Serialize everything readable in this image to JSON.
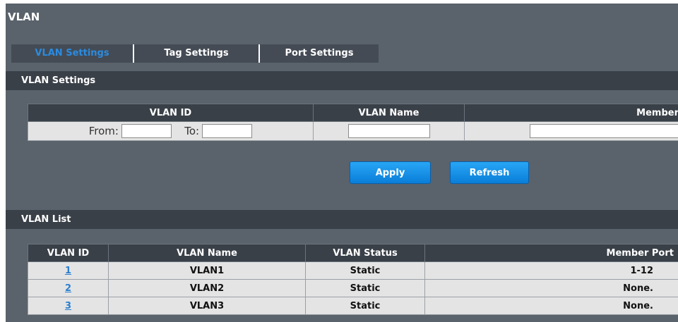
{
  "page": {
    "title": "VLAN"
  },
  "tabs": [
    {
      "label": "VLAN Settings"
    },
    {
      "label": "Tag Settings"
    },
    {
      "label": "Port Settings"
    }
  ],
  "settings": {
    "section_title": "VLAN Settings",
    "headers": {
      "vlan_id": "VLAN ID",
      "vlan_name": "VLAN Name",
      "member": "Member"
    },
    "from_label": "From:",
    "to_label": "To:",
    "from_value": "",
    "to_value": "",
    "name_value": "",
    "member_value": ""
  },
  "buttons": {
    "apply": "Apply",
    "refresh": "Refresh"
  },
  "list": {
    "section_title": "VLAN List",
    "headers": [
      "VLAN ID",
      "VLAN Name",
      "VLAN Status",
      "Member Port"
    ],
    "rows": [
      {
        "id": "1",
        "name": "VLAN1",
        "status": "Static",
        "ports": "1-12"
      },
      {
        "id": "2",
        "name": "VLAN2",
        "status": "Static",
        "ports": "None."
      },
      {
        "id": "3",
        "name": "VLAN3",
        "status": "Static",
        "ports": "None."
      }
    ]
  }
}
